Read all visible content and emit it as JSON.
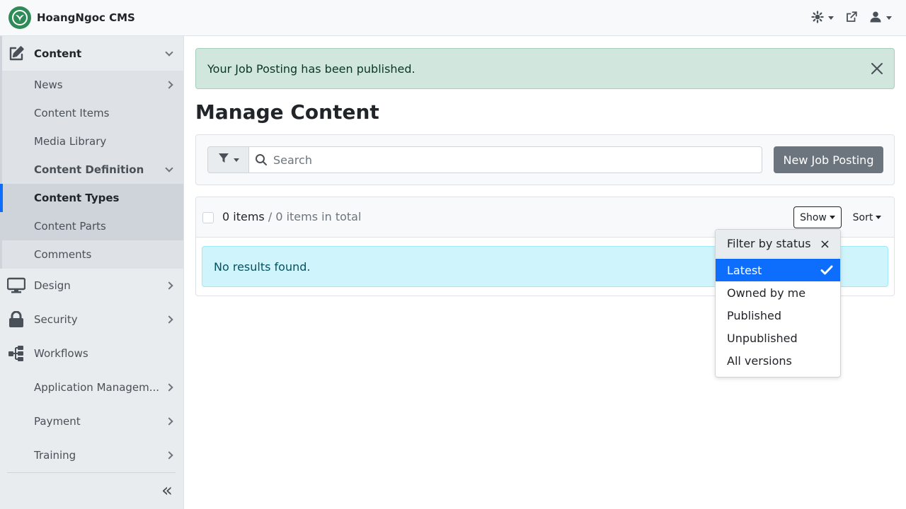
{
  "app": {
    "title": "HoangNgoc CMS"
  },
  "topbar": {
    "icons": [
      "theme-icon",
      "external-link-icon",
      "user-icon"
    ]
  },
  "sidebar": {
    "content": {
      "label": "Content"
    },
    "news": {
      "label": "News"
    },
    "content_items": {
      "label": "Content Items"
    },
    "media_library": {
      "label": "Media Library"
    },
    "content_definition": {
      "label": "Content Definition"
    },
    "content_types": {
      "label": "Content Types"
    },
    "content_parts": {
      "label": "Content Parts"
    },
    "comments": {
      "label": "Comments"
    },
    "design": {
      "label": "Design"
    },
    "security": {
      "label": "Security"
    },
    "workflows": {
      "label": "Workflows"
    },
    "application_management": {
      "label": "Application Managem..."
    },
    "payment": {
      "label": "Payment"
    },
    "training": {
      "label": "Training"
    },
    "collapse_glyph": "«"
  },
  "alert": {
    "message": "Your Job Posting has been published."
  },
  "page": {
    "title": "Manage Content"
  },
  "filter": {
    "search_placeholder": "Search",
    "new_button": "New Job Posting"
  },
  "list": {
    "count_items": "0 items",
    "count_total": "/ 0 items in total",
    "show_label": "Show",
    "sort_label": "Sort",
    "empty_message": "No results found."
  },
  "dropdown": {
    "header": "Filter by status",
    "close_glyph": "×",
    "options": [
      "Latest",
      "Owned by me",
      "Published",
      "Unpublished",
      "All versions"
    ],
    "selected": "Latest"
  },
  "colors": {
    "brand": "#2e8b57",
    "primary": "#0d6efd",
    "success_bg": "#d1e7dd",
    "info_bg": "#cff4fc",
    "secondary": "#6c757d"
  }
}
